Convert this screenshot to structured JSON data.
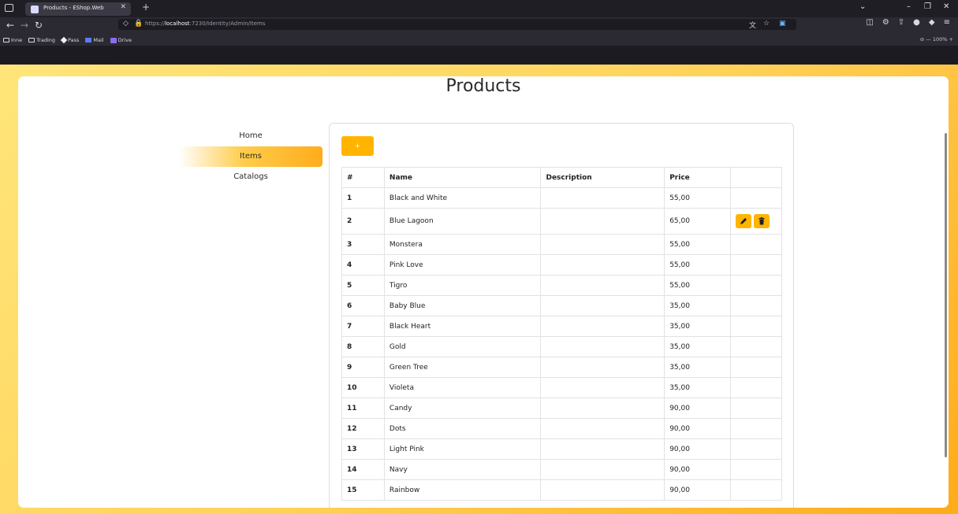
{
  "browser": {
    "tab_title": "Products - EShop.Web",
    "url_scheme": "https://",
    "url_host": "localhost",
    "url_rest": ":7230/Identity/Admin/Items",
    "bookmarks": [
      "Inne",
      "Trading",
      "Pass",
      "Mail",
      "Drive"
    ],
    "zoom": "100%"
  },
  "page": {
    "title": "Products"
  },
  "sidenav": {
    "items": [
      {
        "label": "Home",
        "active": false
      },
      {
        "label": "Items",
        "active": true
      },
      {
        "label": "Catalogs",
        "active": false
      }
    ]
  },
  "toolbar": {
    "add_label": "+"
  },
  "table": {
    "columns": [
      "#",
      "Name",
      "Description",
      "Price",
      ""
    ],
    "rows": [
      {
        "id": "1",
        "name": "Black and White",
        "description": "",
        "price": "55,00"
      },
      {
        "id": "2",
        "name": "Blue Lagoon",
        "description": "",
        "price": "65,00"
      },
      {
        "id": "3",
        "name": "Monstera",
        "description": "",
        "price": "55,00"
      },
      {
        "id": "4",
        "name": "Pink Love",
        "description": "",
        "price": "55,00"
      },
      {
        "id": "5",
        "name": "Tigro",
        "description": "",
        "price": "55,00"
      },
      {
        "id": "6",
        "name": "Baby Blue",
        "description": "",
        "price": "35,00"
      },
      {
        "id": "7",
        "name": "Black Heart",
        "description": "",
        "price": "35,00"
      },
      {
        "id": "8",
        "name": "Gold",
        "description": "",
        "price": "35,00"
      },
      {
        "id": "9",
        "name": "Green Tree",
        "description": "",
        "price": "35,00"
      },
      {
        "id": "10",
        "name": "Violeta",
        "description": "",
        "price": "35,00"
      },
      {
        "id": "11",
        "name": "Candy",
        "description": "",
        "price": "90,00"
      },
      {
        "id": "12",
        "name": "Dots",
        "description": "",
        "price": "90,00"
      },
      {
        "id": "13",
        "name": "Light Pink",
        "description": "",
        "price": "90,00"
      },
      {
        "id": "14",
        "name": "Navy",
        "description": "",
        "price": "90,00"
      },
      {
        "id": "15",
        "name": "Rainbow",
        "description": "",
        "price": "90,00"
      }
    ],
    "hovered_row": "2"
  },
  "colors": {
    "accent": "#ffb400",
    "gradient_start": "#ffe57a",
    "gradient_end": "#ffab1a"
  }
}
